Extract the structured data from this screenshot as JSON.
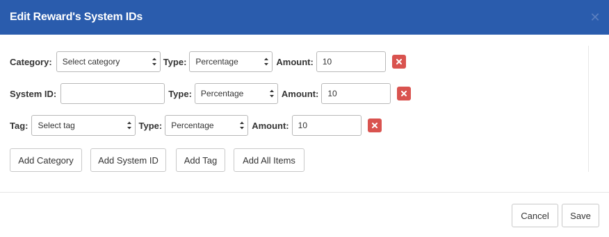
{
  "dialog": {
    "title": "Edit Reward's System IDs",
    "close_icon": "close-icon",
    "accent_color": "#2a5cad"
  },
  "rows": {
    "category": {
      "label": "Category:",
      "select_value": "Select category",
      "type_label": "Type:",
      "type_value": "Percentage",
      "amount_label": "Amount:",
      "amount_value": "10",
      "delete_icon": "close-icon"
    },
    "system_id": {
      "label": "System ID:",
      "input_value": "",
      "type_label": "Type:",
      "type_value": "Percentage",
      "amount_label": "Amount:",
      "amount_value": "10",
      "delete_icon": "close-icon"
    },
    "tag": {
      "label": "Tag:",
      "select_value": "Select tag",
      "type_label": "Type:",
      "type_value": "Percentage",
      "amount_label": "Amount:",
      "amount_value": "10",
      "delete_icon": "close-icon"
    }
  },
  "actions": {
    "add_category": "Add Category",
    "add_system_id": "Add System ID",
    "add_tag": "Add Tag",
    "add_all_items": "Add All Items"
  },
  "footer": {
    "cancel": "Cancel",
    "save": "Save"
  },
  "colors": {
    "danger": "#d9534f"
  }
}
